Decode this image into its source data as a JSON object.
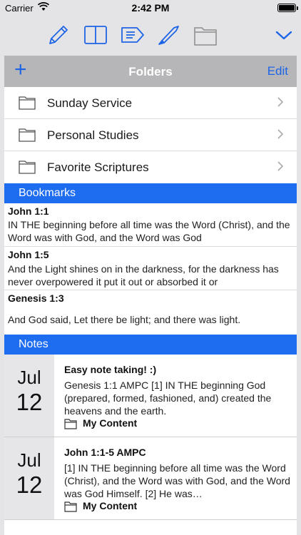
{
  "status_bar": {
    "carrier": "Carrier",
    "time": "2:42 PM"
  },
  "toolbar": {
    "icons": [
      "pencil-icon",
      "book-icon",
      "tag-icon",
      "highlighter-icon",
      "folder-icon",
      "chevron-down-icon"
    ],
    "accent_color": "#1e64e6"
  },
  "folders": {
    "add_label": "+",
    "title": "Folders",
    "edit_label": "Edit",
    "items": [
      {
        "label": "Sunday Service"
      },
      {
        "label": "Personal Studies"
      },
      {
        "label": "Favorite Scriptures"
      }
    ]
  },
  "bookmarks": {
    "header": "Bookmarks",
    "items": [
      {
        "ref": "John 1:1",
        "text": "IN THE beginning before all time was the Word (Christ), and the Word was with God, and the Word was God"
      },
      {
        "ref": "John 1:5",
        "text": "And the Light shines on in the darkness, for the darkness has never overpowered it put it out or absorbed it or"
      },
      {
        "ref": "Genesis 1:3",
        "text": "And God said, Let there be light; and there was light."
      }
    ]
  },
  "notes": {
    "header": "Notes",
    "items": [
      {
        "month": "Jul",
        "day": "12",
        "title": "Easy note taking! :)",
        "body": "Genesis 1:1 AMPC [1] IN THE beginning God (prepared, formed, fashioned, and) created the heavens and the earth.",
        "folder": "My Content"
      },
      {
        "month": "Jul",
        "day": "12",
        "title": "John 1:1-5 AMPC",
        "body": "[1] IN THE beginning before all time was the Word (Christ), and the Word was with God, and the Word was God Himself. [2] He was…",
        "folder": "My Content"
      }
    ]
  },
  "colors": {
    "section_bar": "#1e6cf0",
    "folders_header": "#b6b6b8",
    "background": "#e4e4e6"
  }
}
